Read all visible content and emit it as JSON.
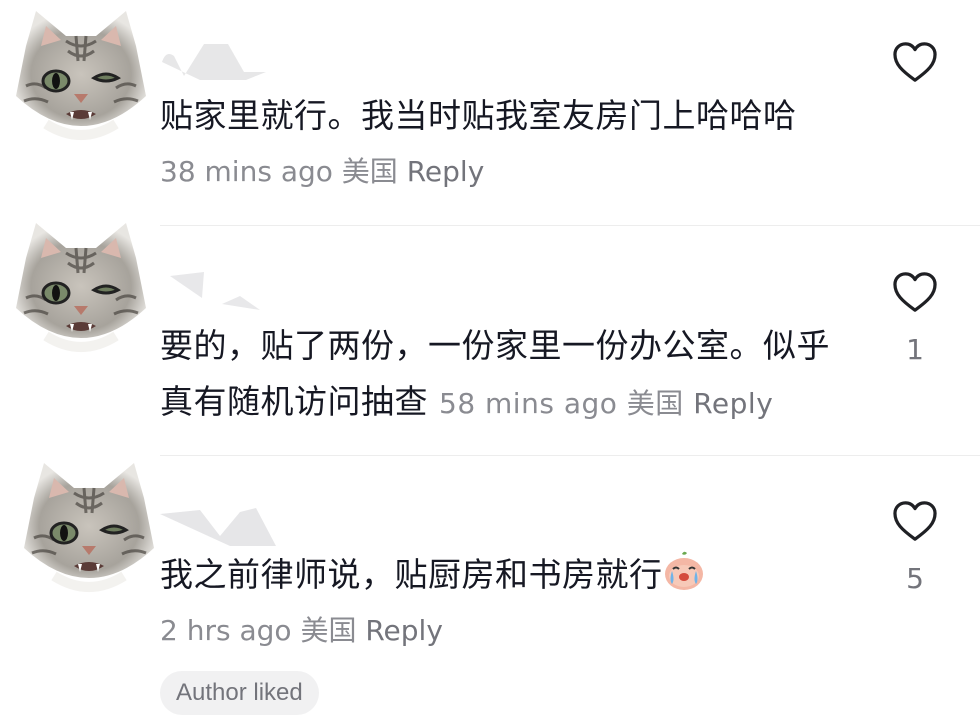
{
  "comments": [
    {
      "content": "贴家里就行。我当时贴我室友房门上哈哈哈",
      "time": "38 mins ago",
      "location": "美国",
      "reply_label": "Reply",
      "like_count": ""
    },
    {
      "content": "要的，贴了两份，一份家里一份办公室。似乎真有随机访问抽查",
      "time": "58 mins ago",
      "location": "美国",
      "reply_label": "Reply",
      "like_count": "1"
    },
    {
      "content": "我之前律师说，贴厨房和书房就行",
      "time": "2 hrs ago",
      "location": "美国",
      "reply_label": "Reply",
      "like_count": "5",
      "badge": "Author liked"
    }
  ],
  "colors": {
    "text": "#161823",
    "meta": "#8a8b91",
    "divider": "#ededed",
    "badge_bg": "#f1f1f2"
  },
  "icons": [
    "cat-avatar-icon",
    "heart-outline-icon",
    "crying-face-emoji-icon"
  ]
}
